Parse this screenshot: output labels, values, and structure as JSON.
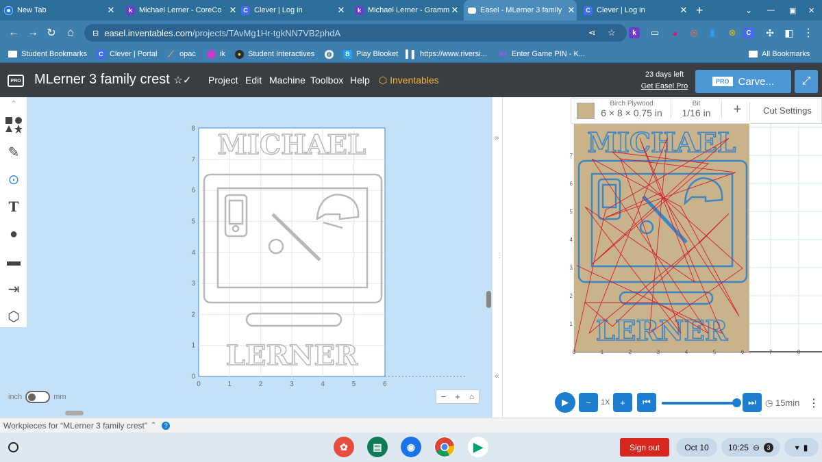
{
  "tabs": [
    {
      "title": "New Tab",
      "icon": "chrome-icon",
      "color": "#1a73e8"
    },
    {
      "title": "Michael Lerner - CoreCo",
      "icon": "k-icon",
      "color": "#6a3ec6"
    },
    {
      "title": "Clever | Log in",
      "icon": "clever-icon",
      "color": "#436cf2"
    },
    {
      "title": "Michael Lerner - Gramm",
      "icon": "k-icon",
      "color": "#6a3ec6"
    },
    {
      "title": "Easel - MLerner 3 family",
      "icon": "easel-icon",
      "color": "#ffffff",
      "active": true
    },
    {
      "title": "Clever | Log in",
      "icon": "clever-icon",
      "color": "#436cf2"
    }
  ],
  "address": {
    "host": "easel.inventables.com",
    "path": "/projects/TAvMg1Hr-tgkNN7VB2phdA"
  },
  "bookmarks": [
    {
      "label": "Student Bookmarks",
      "icon": "folder-icon",
      "color": "#ffffff"
    },
    {
      "label": "Clever | Portal",
      "icon": "clever-icon",
      "color": "#436cf2"
    },
    {
      "label": "opac",
      "icon": "feather-icon",
      "color": "#e8a33d"
    },
    {
      "label": "ik",
      "icon": "ik-icon",
      "color": "#c23bcb"
    },
    {
      "label": "Student Interactives",
      "icon": "alien-icon",
      "color": "#2a2a2a"
    },
    {
      "label": "",
      "icon": "globe-icon",
      "color": "#ffffff"
    },
    {
      "label": "Play Blooket",
      "icon": "blooket-icon",
      "color": "#1aa4f0"
    },
    {
      "label": "https://www.riversi...",
      "icon": "bar-chart-icon",
      "color": "#e0e0e0"
    },
    {
      "label": "Enter Game PIN - K...",
      "icon": "kahoot-icon",
      "color": "#46178f"
    },
    {
      "label": "All Bookmarks",
      "icon": "folder-icon",
      "color": "#ffffff"
    }
  ],
  "easel": {
    "logo": "PRO",
    "project_title": "MLerner 3 family crest",
    "menu": [
      "Project",
      "Edit",
      "Machine",
      "Toolbox",
      "Help"
    ],
    "inventables": "Inventables",
    "days_left": "23 days left",
    "get_pro": "Get Easel Pro",
    "carve_pro": "PRO",
    "carve_label": "Carve..."
  },
  "design": {
    "top_text": "MICHAEL",
    "bottom_text": "LERNER",
    "x_ticks": [
      "0",
      "1",
      "2",
      "3",
      "4",
      "5",
      "6"
    ],
    "y_ticks": [
      "0",
      "1",
      "2",
      "3",
      "4",
      "5",
      "6",
      "7",
      "8"
    ]
  },
  "units": {
    "left": "inch",
    "right": "mm"
  },
  "zoom": {
    "minus": "−",
    "plus": "+"
  },
  "material": {
    "name": "Birch Plywood",
    "size": "6 × 8 × 0.75 in",
    "swatch": "#c9b38b"
  },
  "bit": {
    "label": "Bit",
    "size": "1/16 in"
  },
  "add_label": "+",
  "cut_settings": "Cut Settings",
  "preview": {
    "x_ticks": [
      "0",
      "1",
      "2",
      "3",
      "4",
      "5",
      "6",
      "7",
      "8"
    ],
    "y_ticks": [
      "1",
      "2",
      "3",
      "4",
      "5",
      "6",
      "7"
    ]
  },
  "playback": {
    "speed": "1X",
    "duration": "15min",
    "progress": 1.0
  },
  "workpieces_label": "Workpieces for “MLerner 3 family crest”",
  "shelf": {
    "sign_out": "Sign out",
    "date": "Oct 10",
    "time": "10:25",
    "notifications": "3"
  }
}
